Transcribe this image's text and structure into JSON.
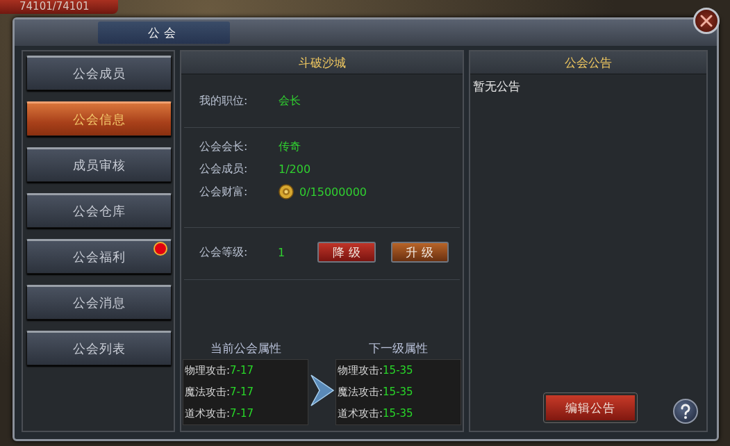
{
  "hud": {
    "hp": "74101/74101"
  },
  "window": {
    "title": "公会"
  },
  "sidebar": {
    "items": [
      {
        "label": "公会成员",
        "selected": false,
        "alert": false
      },
      {
        "label": "公会信息",
        "selected": true,
        "alert": false
      },
      {
        "label": "成员审核",
        "selected": false,
        "alert": false
      },
      {
        "label": "公会仓库",
        "selected": false,
        "alert": false
      },
      {
        "label": "公会福利",
        "selected": false,
        "alert": true
      },
      {
        "label": "公会消息",
        "selected": false,
        "alert": false
      },
      {
        "label": "公会列表",
        "selected": false,
        "alert": false
      }
    ]
  },
  "guild": {
    "name": "斗破沙城",
    "position": {
      "label": "我的职位:",
      "value": "会长"
    },
    "details": [
      {
        "label": "公会会长:",
        "value": "传奇",
        "kind": "text"
      },
      {
        "label": "公会成员:",
        "value": "1/200",
        "kind": "text"
      },
      {
        "label": "公会财富:",
        "value": "0/15000000",
        "kind": "coin"
      }
    ],
    "level": {
      "label": "公会等级:",
      "value": "1",
      "buttons": [
        {
          "label": "降级",
          "kind": "downgrade"
        },
        {
          "label": "升级",
          "kind": "upgrade"
        }
      ]
    },
    "current_attributes": {
      "title": "当前公会属性",
      "rows": [
        {
          "label": "物理攻击:",
          "value": "7-17"
        },
        {
          "label": "魔法攻击:",
          "value": "7-17"
        },
        {
          "label": "道术攻击:",
          "value": "7-17"
        }
      ]
    },
    "next_attributes": {
      "title": "下一级属性",
      "rows": [
        {
          "label": "物理攻击:",
          "value": "15-35"
        },
        {
          "label": "魔法攻击:",
          "value": "15-35"
        },
        {
          "label": "道术攻击:",
          "value": "15-35"
        }
      ]
    }
  },
  "notice": {
    "title": "公会公告",
    "text": "暂无公告",
    "edit_button": "编辑公告"
  }
}
